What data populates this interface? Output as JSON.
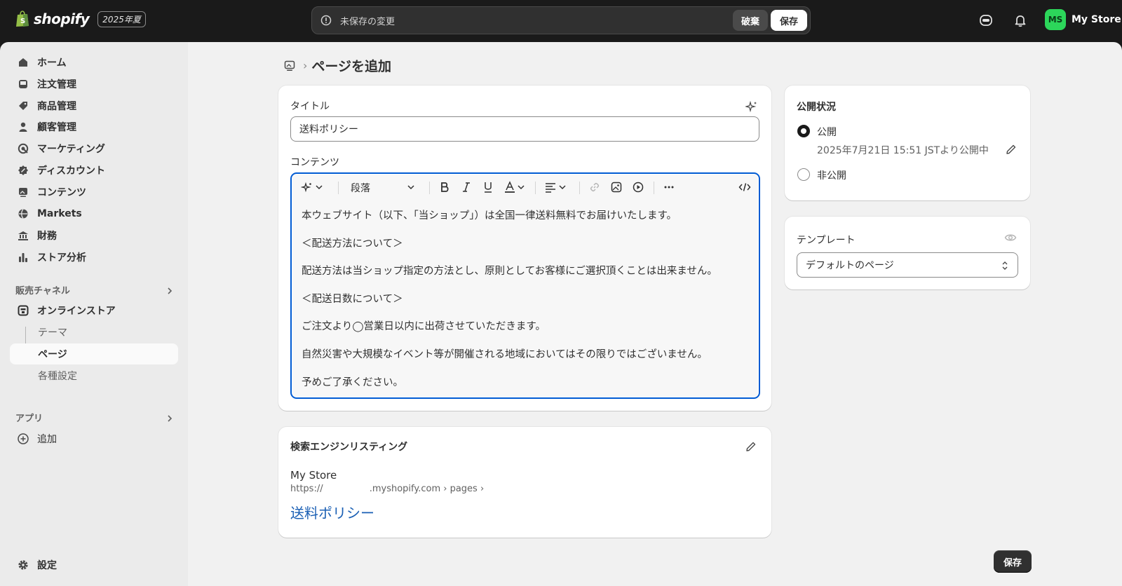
{
  "topbar": {
    "logo_text": "shopify",
    "edition_badge": "2025年夏",
    "unsaved_message": "未保存の変更",
    "discard_label": "破棄",
    "save_label": "保存",
    "avatar_initials": "MS",
    "store_name": "My Store"
  },
  "sidebar": {
    "nav": [
      {
        "label": "ホーム",
        "icon": "home-icon"
      },
      {
        "label": "注文管理",
        "icon": "inbox-icon"
      },
      {
        "label": "商品管理",
        "icon": "tag-icon"
      },
      {
        "label": "顧客管理",
        "icon": "person-icon"
      },
      {
        "label": "マーケティング",
        "icon": "target-icon"
      },
      {
        "label": "ディスカウント",
        "icon": "discount-icon"
      },
      {
        "label": "コンテンツ",
        "icon": "image-icon"
      },
      {
        "label": "Markets",
        "icon": "globe-icon"
      },
      {
        "label": "財務",
        "icon": "bank-icon"
      },
      {
        "label": "ストア分析",
        "icon": "bar-chart-icon"
      }
    ],
    "sales_channels_title": "販売チャネル",
    "online_store_label": "オンラインストア",
    "online_store_sub": [
      "テーマ",
      "ページ",
      "各種設定"
    ],
    "apps_title": "アプリ",
    "add_label": "追加",
    "settings_label": "設定"
  },
  "page": {
    "title": "ページを追加"
  },
  "editor_card": {
    "title_label": "タイトル",
    "title_value": "送料ポリシー",
    "content_label": "コンテンツ",
    "format_select": "段落",
    "paragraphs": [
      "本ウェブサイト（以下、「当ショップ」）は全国一律送料無料でお届けいたします。",
      "＜配送方法について＞",
      "配送方法は当ショップ指定の方法とし、原則としてお客様にご選択頂くことは出来ません。",
      "＜配送日数について＞",
      "ご注文より◯営業日以内に出荷させていただきます。",
      "自然災害や大規模なイベント等が開催される地域においてはその限りではございません。",
      "予めご了承ください。"
    ]
  },
  "seo_card": {
    "title": "検索エンジンリスティング",
    "store_name": "My Store",
    "url": "https://                .myshopify.com › pages ›",
    "page_title": "送料ポリシー"
  },
  "visibility_card": {
    "title": "公開状況",
    "public_label": "公開",
    "published_date": "2025年7月21日 15:51 JSTより公開中",
    "hidden_label": "非公開"
  },
  "template_card": {
    "title": "テンプレート",
    "selected": "デフォルトのページ"
  },
  "footer": {
    "save_label": "保存"
  },
  "colors": {
    "focus_border": "#005bd3",
    "link_blue": "#1a5fb4",
    "avatar_green": "#2cd65a",
    "topbar_bg": "#1a1a1a"
  }
}
